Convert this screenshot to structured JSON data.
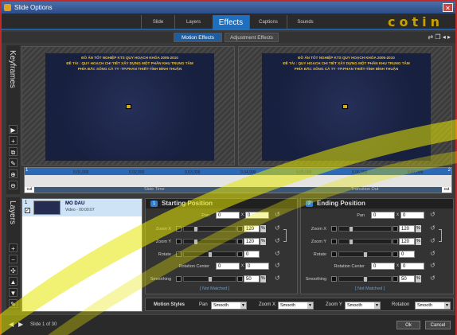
{
  "window": {
    "title": "Slide Options"
  },
  "tabs": [
    "Slide",
    "Layers",
    "Effects",
    "Captions",
    "Sounds"
  ],
  "active_tab": "Effects",
  "brand_text": "cotin",
  "subtabs": [
    "Motion Effects",
    "Adjustment Effects"
  ],
  "active_subtab": "Motion Effects",
  "keyframes_label": "Keyframes",
  "layers_label": "Layers",
  "slide_text": {
    "line1": "ĐỒ ÁN TỐT NGHIỆP KTS QUY HOẠCH KHÓA 2005-2010",
    "line2": "ĐỀ TÀI : QUY HOẠCH CHI TIẾT XÂY DỰNG MỘT PHẦN KHU TRUNG TÂM",
    "line3": "PHÍA BẮC SÔNG CÀ TY -TP.PHAN THIẾT-TỈNH BÌNH THUẬN"
  },
  "timeline": {
    "start_marker": "1",
    "end_marker": "2",
    "ticks": [
      "0.01,000",
      "0.02,000",
      "0.03,000",
      "0.04,000",
      "0.05,000",
      "0.06,000",
      "0.07,000"
    ],
    "slide_time": "Slide Time",
    "transition_out": "Transition Out",
    "cut_left": "cut",
    "cut_right": "cut"
  },
  "layer": {
    "number": "1",
    "name": "MO DAU",
    "info": "Video - 00:00:07",
    "checked": true
  },
  "start_panel": {
    "number": "1",
    "title": "Starting Position",
    "pan_label": "Pan",
    "pan_x": "0",
    "pan_y": "0",
    "zoomx_label": "Zoom X",
    "zoomx": "120",
    "zoomy_label": "Zoom Y",
    "zoomy": "120",
    "rotate_label": "Rotate",
    "rotate": "0",
    "rotcenter_label": "Rotation Center",
    "rc_x": "0",
    "rc_y": "0",
    "smoothing_label": "Smoothing",
    "smoothing": "50",
    "not_matched": "[ Not Matched ]"
  },
  "end_panel": {
    "number": "2",
    "title": "Ending Position",
    "pan_label": "Pan",
    "pan_x": "0",
    "pan_y": "0",
    "zoomx_label": "Zoom X",
    "zoomx": "120",
    "zoomy_label": "Zoom Y",
    "zoomy": "120",
    "rotate_label": "Rotate",
    "rotate": "0",
    "rotcenter_label": "Rotation Center",
    "rc_x": "0",
    "rc_y": "0",
    "smoothing_label": "Smoothing",
    "smoothing": "50",
    "not_matched": "[ Not Matched ]"
  },
  "percent_sign": "%",
  "x_sep": "x",
  "motion_styles": {
    "label": "Motion Styles",
    "pan_label": "Pan",
    "pan_value": "Smooth",
    "zoomx_label": "Zoom X",
    "zoomx_value": "Smooth",
    "zoomy_label": "Zoom Y",
    "zoomy_value": "Smooth",
    "rotation_label": "Rotation",
    "rotation_value": "Smooth"
  },
  "footer": {
    "slide_label": "Slide 1 of 30",
    "ok": "Ok",
    "cancel": "Cancel"
  },
  "colors": {
    "accent": "#1e6fbf",
    "window_border": "#c02a2a",
    "slide_text": "#e8c23a",
    "watermark": "#e6e600"
  }
}
